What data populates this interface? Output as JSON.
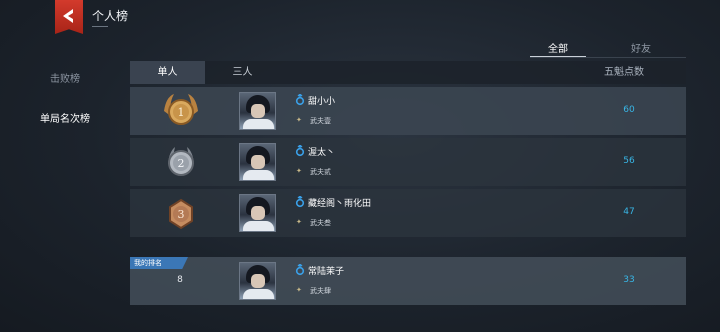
{
  "header": {
    "title": "个人榜"
  },
  "filters": {
    "all": "全部",
    "friends": "好友"
  },
  "sidebar": {
    "items": [
      {
        "label": "击败榜"
      },
      {
        "label": "单局名次榜"
      }
    ]
  },
  "table": {
    "tabs": [
      {
        "label": "单人"
      },
      {
        "label": "三人"
      }
    ],
    "score_header": "五魁点数",
    "rows": [
      {
        "rank": "1",
        "name": "甜小小",
        "title": "武夫壹",
        "score": "60"
      },
      {
        "rank": "2",
        "name": "渥太丶",
        "title": "武夫贰",
        "score": "56"
      },
      {
        "rank": "3",
        "name": "藏经阁丶雨化田",
        "title": "武夫叁",
        "score": "47"
      }
    ]
  },
  "me": {
    "badge": "我的排名",
    "rank": "8",
    "name": "常陆茉子",
    "title": "武夫肆",
    "score": "33"
  },
  "colors": {
    "gold": "#c8944a",
    "silver": "#9aa1aa",
    "bronze": "#b47a55",
    "accent": "#38b6e6",
    "gender": "#3aa0e8",
    "back": "#d33a2c"
  },
  "icons": {
    "back": "back-arrow-icon",
    "gender": "male-icon",
    "rank": "rank-emblem-icon"
  }
}
